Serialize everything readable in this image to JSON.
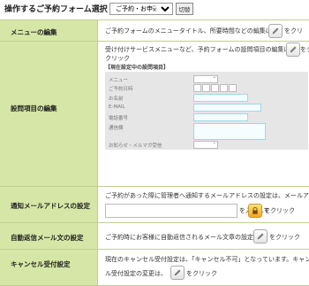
{
  "header": {
    "title": "操作するご予約フォーム選択",
    "form_select_value": "ご予約・お申込",
    "switch_label": "切替"
  },
  "rows": {
    "menu": {
      "label": "メニューの編集",
      "text": "ご予約フォームのメニュータイトル、所要時間などの編集は",
      "after": "をクリ"
    },
    "fields": {
      "label": "設問項目の編集",
      "text1": "受け付けサービスメニューなど、予約フォームの設問項目の編集は",
      "text1_after": "をク",
      "text2": "クリック",
      "current_title": "【現在設定中の設問項目】",
      "preview_labels": [
        "メニュー",
        "ご予約日時",
        "お名前",
        "E-MAIL",
        "電話番号",
        "通信欄",
        "お知らせ・メルマガ受信"
      ]
    },
    "notify": {
      "label": "通知メールアドレスの設定",
      "text": "ご予約があった際に管理者へ通知するメールアドレスの設定は、メールアドレ",
      "after": "を入力して",
      "click": "をクリック"
    },
    "autoreply": {
      "label": "自動返信メール文の設定",
      "text": "ご予約時にお客様に自動返信されるメール文章の設定は",
      "after": "をクリック"
    },
    "cancel": {
      "label": "キャンセル受付設定",
      "text1": "現在のキャンセル受付設定は、「キャンセル不可」となっています。キャンセ",
      "text2": "ル受付設定の変更は、",
      "after": "をクリック"
    }
  }
}
